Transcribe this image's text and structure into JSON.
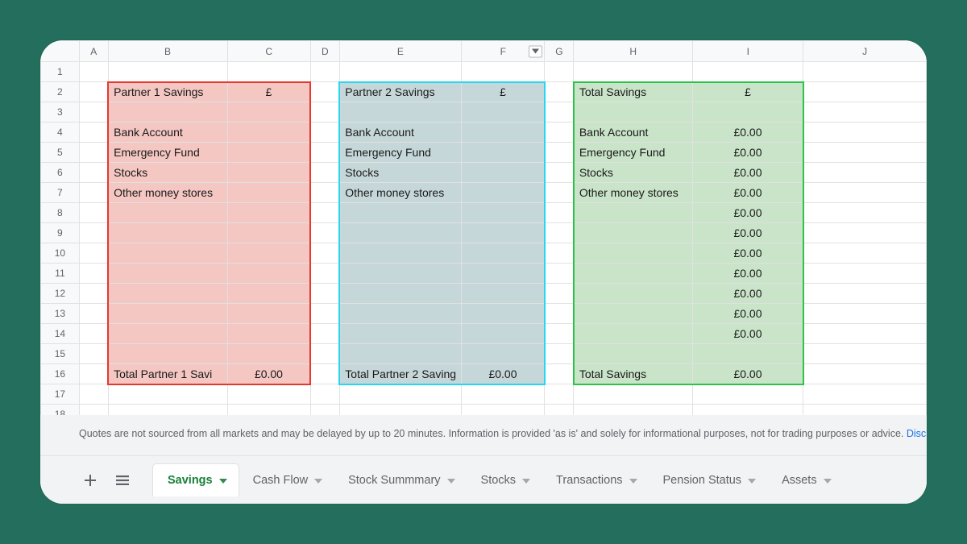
{
  "columns": [
    "A",
    "B",
    "C",
    "D",
    "E",
    "F",
    "G",
    "H",
    "I",
    "J"
  ],
  "row_count": 19,
  "cells": {
    "B2": "Partner 1 Savings",
    "C2": "£",
    "E2": "Partner 2 Savings",
    "F2": "£",
    "H2": "Total Savings",
    "I2": "£",
    "B4": "Bank Account",
    "B5": "Emergency Fund",
    "B6": "Stocks",
    "B7": "Other money stores",
    "E4": "Bank Account",
    "E5": "Emergency Fund",
    "E6": "Stocks",
    "E7": "Other money stores",
    "H4": "Bank Account",
    "H5": "Emergency Fund",
    "H6": "Stocks",
    "H7": "Other money stores",
    "I4": "£0.00",
    "I5": "£0.00",
    "I6": "£0.00",
    "I7": "£0.00",
    "I8": "£0.00",
    "I9": "£0.00",
    "I10": "£0.00",
    "I11": "£0.00",
    "I12": "£0.00",
    "I13": "£0.00",
    "I14": "£0.00",
    "B16": "Total Partner 1 Savi",
    "C16": "£0.00",
    "E16": "Total Partner 2 Saving",
    "F16": "£0.00",
    "H16": "Total Savings",
    "I16": "£0.00"
  },
  "disclaimer": {
    "text": "Quotes are not sourced from all markets and may be delayed by up to 20 minutes. Information is provided 'as is' and solely for informational purposes, not for trading purposes or advice. ",
    "link": "Disclaim"
  },
  "tabs": [
    {
      "label": "Savings",
      "active": true
    },
    {
      "label": "Cash Flow"
    },
    {
      "label": "Stock Summmary"
    },
    {
      "label": "Stocks"
    },
    {
      "label": "Transactions"
    },
    {
      "label": "Pension Status"
    },
    {
      "label": "Assets"
    }
  ]
}
